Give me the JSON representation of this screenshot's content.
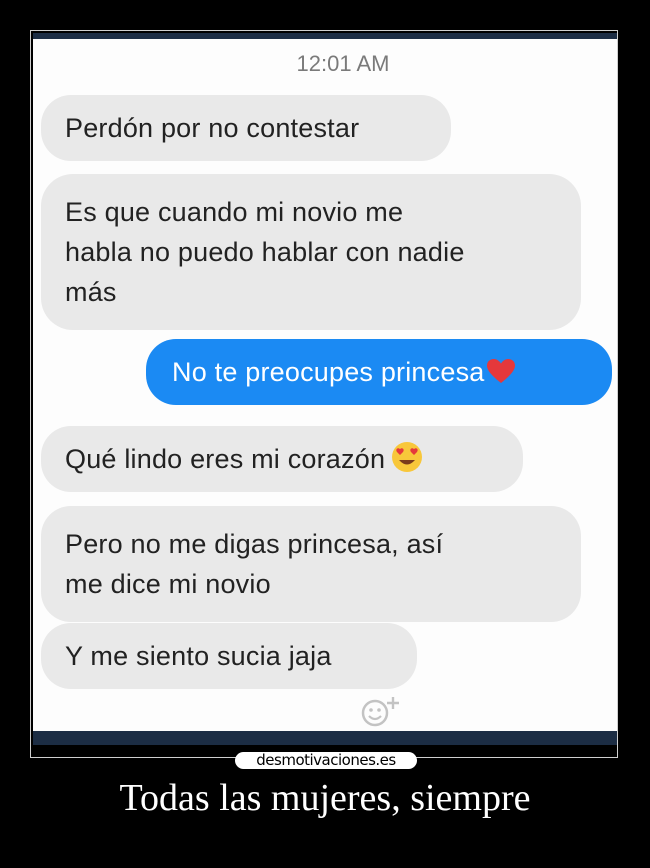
{
  "conversation": {
    "timestamp": "12:01 AM",
    "messages": [
      {
        "direction": "incoming",
        "text": "Perdón por no contestar"
      },
      {
        "direction": "incoming",
        "lines": [
          "Es que cuando mi novio me",
          "habla no puedo hablar con nadie",
          "más"
        ]
      },
      {
        "direction": "outgoing",
        "text": "No te preocupes princesa",
        "emoji": "red-heart"
      },
      {
        "direction": "incoming",
        "text": "Qué lindo eres mi corazón",
        "emoji": "heart-eyes"
      },
      {
        "direction": "incoming",
        "lines": [
          "Pero no me digas princesa, así",
          "me dice mi novio"
        ]
      },
      {
        "direction": "incoming",
        "text": "Y me siento sucia jaja"
      }
    ],
    "reaction_button": {
      "icon": "smiley-plus-icon"
    }
  },
  "watermark": "desmotivaciones.es",
  "caption": "Todas las mujeres, siempre",
  "colors": {
    "incoming_bubble": "#e9e9e9",
    "outgoing_bubble": "#1b8af3",
    "background": "#000000"
  }
}
